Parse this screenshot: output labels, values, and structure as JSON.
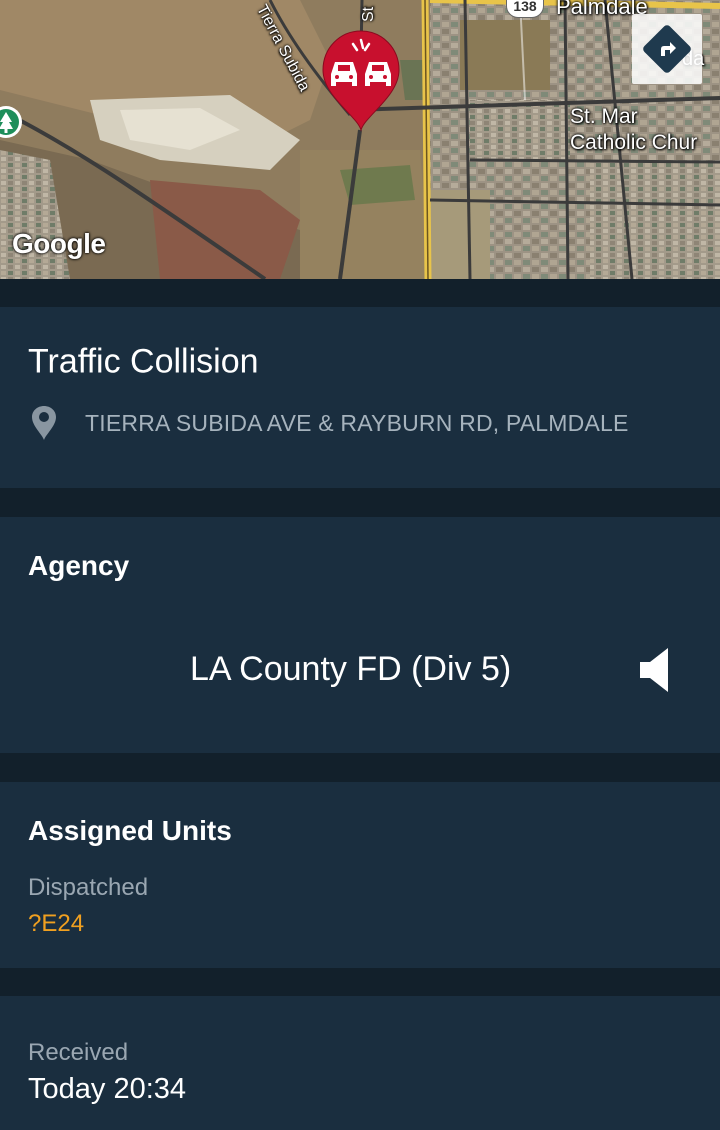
{
  "map": {
    "labels": {
      "palmdale": "Palmdale",
      "route_number": "138",
      "st_mary_line1": "St. Mar",
      "st_mary_line2": "Catholic Chur",
      "tierra_subida": "Tierra Subida",
      "street_st": "St",
      "palmdale_partial": "da"
    },
    "attribution": "Google",
    "icons": {
      "directions": "directions-icon",
      "incident": "traffic-collision-icon",
      "park": "park-tree-icon"
    },
    "pin_color": "#c8102e"
  },
  "incident": {
    "title": "Traffic Collision",
    "location_icon": "location-pin-icon",
    "address": "TIERRA SUBIDA AVE & RAYBURN RD, PALMDALE"
  },
  "agency": {
    "heading": "Agency",
    "name": "LA County FD (Div 5)",
    "audio_icon": "speaker-icon"
  },
  "units": {
    "heading": "Assigned Units",
    "status_label": "Dispatched",
    "unit": "?E24",
    "unit_color": "#f0a020"
  },
  "received": {
    "label": "Received",
    "value": "Today 20:34"
  },
  "colors": {
    "background": "#12202b",
    "panel": "#1a2e3f",
    "secondary_text": "#a6b3bd"
  }
}
